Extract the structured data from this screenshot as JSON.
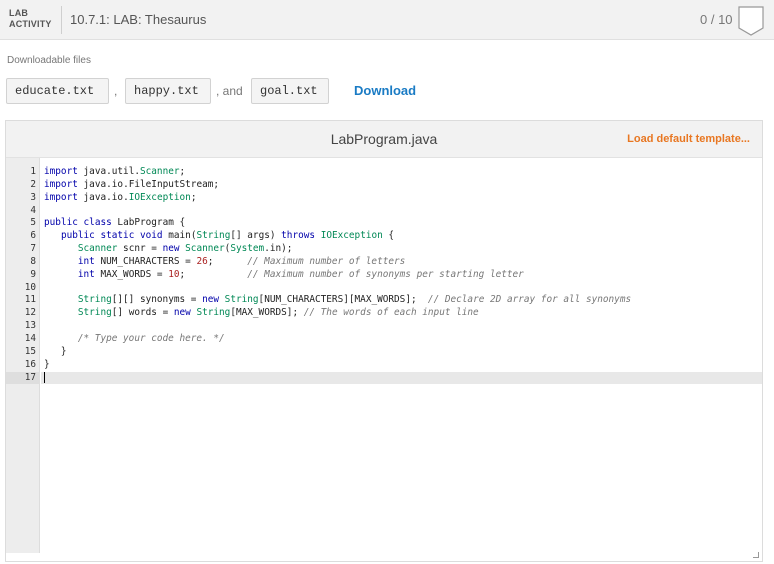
{
  "header": {
    "badge_line1": "LAB",
    "badge_line2": "ACTIVITY",
    "title": "10.7.1: LAB: Thesaurus",
    "score": "0 / 10"
  },
  "downloads": {
    "label": "Downloadable files",
    "files": [
      "educate.txt",
      "happy.txt",
      "goal.txt"
    ],
    "sep1": ",",
    "sep2": ", and",
    "download_label": "Download"
  },
  "editor": {
    "file_name": "LabProgram.java",
    "load_default_label": "Load default template...",
    "active_line": 17,
    "lines": [
      "import java.util.Scanner;",
      "import java.io.FileInputStream;",
      "import java.io.IOException;",
      "",
      "public class LabProgram {",
      "   public static void main(String[] args) throws IOException {",
      "      Scanner scnr = new Scanner(System.in);",
      "      int NUM_CHARACTERS = 26;      // Maximum number of letters",
      "      int MAX_WORDS = 10;           // Maximum number of synonyms per starting letter",
      "",
      "      String[][] synonyms = new String[NUM_CHARACTERS][MAX_WORDS];  // Declare 2D array for all synonyms",
      "      String[] words = new String[MAX_WORDS]; // The words of each input line",
      "",
      "      /* Type your code here. */",
      "   }",
      "}",
      ""
    ]
  },
  "colors": {
    "accent_link": "#1a7bc4",
    "accent_orange": "#e87722"
  }
}
